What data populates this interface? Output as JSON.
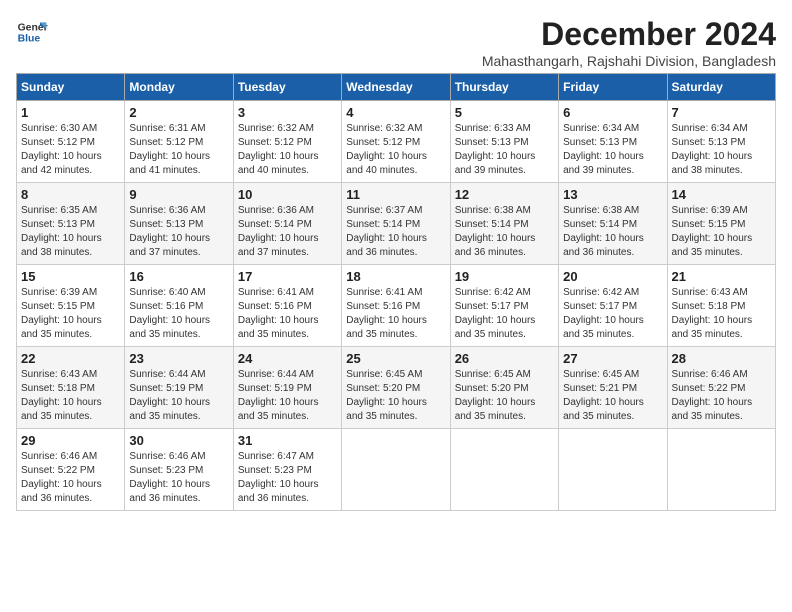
{
  "logo": {
    "line1": "General",
    "line2": "Blue"
  },
  "title": "December 2024",
  "subtitle": "Mahasthangarh, Rajshahi Division, Bangladesh",
  "weekdays": [
    "Sunday",
    "Monday",
    "Tuesday",
    "Wednesday",
    "Thursday",
    "Friday",
    "Saturday"
  ],
  "weeks": [
    [
      {
        "day": 1,
        "sunrise": "6:30 AM",
        "sunset": "5:12 PM",
        "daylight": "10 hours and 42 minutes."
      },
      {
        "day": 2,
        "sunrise": "6:31 AM",
        "sunset": "5:12 PM",
        "daylight": "10 hours and 41 minutes."
      },
      {
        "day": 3,
        "sunrise": "6:32 AM",
        "sunset": "5:12 PM",
        "daylight": "10 hours and 40 minutes."
      },
      {
        "day": 4,
        "sunrise": "6:32 AM",
        "sunset": "5:12 PM",
        "daylight": "10 hours and 40 minutes."
      },
      {
        "day": 5,
        "sunrise": "6:33 AM",
        "sunset": "5:13 PM",
        "daylight": "10 hours and 39 minutes."
      },
      {
        "day": 6,
        "sunrise": "6:34 AM",
        "sunset": "5:13 PM",
        "daylight": "10 hours and 39 minutes."
      },
      {
        "day": 7,
        "sunrise": "6:34 AM",
        "sunset": "5:13 PM",
        "daylight": "10 hours and 38 minutes."
      }
    ],
    [
      {
        "day": 8,
        "sunrise": "6:35 AM",
        "sunset": "5:13 PM",
        "daylight": "10 hours and 38 minutes."
      },
      {
        "day": 9,
        "sunrise": "6:36 AM",
        "sunset": "5:13 PM",
        "daylight": "10 hours and 37 minutes."
      },
      {
        "day": 10,
        "sunrise": "6:36 AM",
        "sunset": "5:14 PM",
        "daylight": "10 hours and 37 minutes."
      },
      {
        "day": 11,
        "sunrise": "6:37 AM",
        "sunset": "5:14 PM",
        "daylight": "10 hours and 36 minutes."
      },
      {
        "day": 12,
        "sunrise": "6:38 AM",
        "sunset": "5:14 PM",
        "daylight": "10 hours and 36 minutes."
      },
      {
        "day": 13,
        "sunrise": "6:38 AM",
        "sunset": "5:14 PM",
        "daylight": "10 hours and 36 minutes."
      },
      {
        "day": 14,
        "sunrise": "6:39 AM",
        "sunset": "5:15 PM",
        "daylight": "10 hours and 35 minutes."
      }
    ],
    [
      {
        "day": 15,
        "sunrise": "6:39 AM",
        "sunset": "5:15 PM",
        "daylight": "10 hours and 35 minutes."
      },
      {
        "day": 16,
        "sunrise": "6:40 AM",
        "sunset": "5:16 PM",
        "daylight": "10 hours and 35 minutes."
      },
      {
        "day": 17,
        "sunrise": "6:41 AM",
        "sunset": "5:16 PM",
        "daylight": "10 hours and 35 minutes."
      },
      {
        "day": 18,
        "sunrise": "6:41 AM",
        "sunset": "5:16 PM",
        "daylight": "10 hours and 35 minutes."
      },
      {
        "day": 19,
        "sunrise": "6:42 AM",
        "sunset": "5:17 PM",
        "daylight": "10 hours and 35 minutes."
      },
      {
        "day": 20,
        "sunrise": "6:42 AM",
        "sunset": "5:17 PM",
        "daylight": "10 hours and 35 minutes."
      },
      {
        "day": 21,
        "sunrise": "6:43 AM",
        "sunset": "5:18 PM",
        "daylight": "10 hours and 35 minutes."
      }
    ],
    [
      {
        "day": 22,
        "sunrise": "6:43 AM",
        "sunset": "5:18 PM",
        "daylight": "10 hours and 35 minutes."
      },
      {
        "day": 23,
        "sunrise": "6:44 AM",
        "sunset": "5:19 PM",
        "daylight": "10 hours and 35 minutes."
      },
      {
        "day": 24,
        "sunrise": "6:44 AM",
        "sunset": "5:19 PM",
        "daylight": "10 hours and 35 minutes."
      },
      {
        "day": 25,
        "sunrise": "6:45 AM",
        "sunset": "5:20 PM",
        "daylight": "10 hours and 35 minutes."
      },
      {
        "day": 26,
        "sunrise": "6:45 AM",
        "sunset": "5:20 PM",
        "daylight": "10 hours and 35 minutes."
      },
      {
        "day": 27,
        "sunrise": "6:45 AM",
        "sunset": "5:21 PM",
        "daylight": "10 hours and 35 minutes."
      },
      {
        "day": 28,
        "sunrise": "6:46 AM",
        "sunset": "5:22 PM",
        "daylight": "10 hours and 35 minutes."
      }
    ],
    [
      {
        "day": 29,
        "sunrise": "6:46 AM",
        "sunset": "5:22 PM",
        "daylight": "10 hours and 36 minutes."
      },
      {
        "day": 30,
        "sunrise": "6:46 AM",
        "sunset": "5:23 PM",
        "daylight": "10 hours and 36 minutes."
      },
      {
        "day": 31,
        "sunrise": "6:47 AM",
        "sunset": "5:23 PM",
        "daylight": "10 hours and 36 minutes."
      },
      null,
      null,
      null,
      null
    ]
  ],
  "labels": {
    "sunrise": "Sunrise:",
    "sunset": "Sunset:",
    "daylight": "Daylight:"
  }
}
